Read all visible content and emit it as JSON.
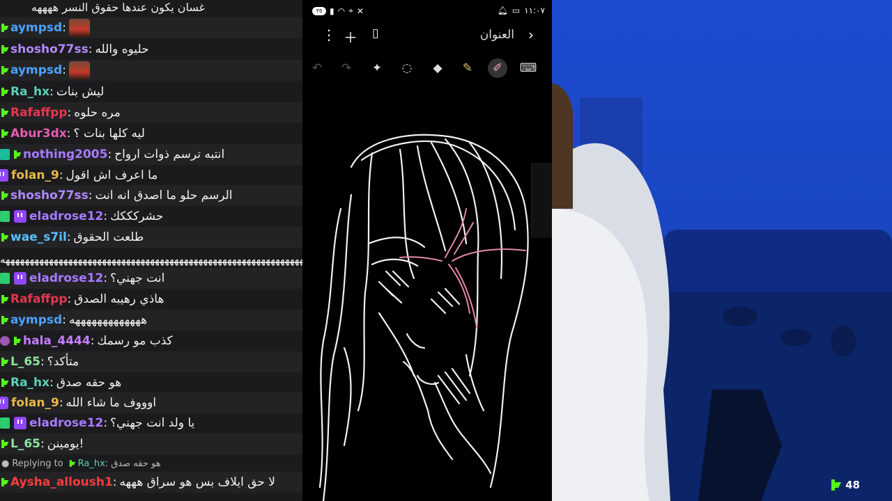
{
  "chat": {
    "top_line": "غسان يكون عندها حقوق النسر ههههه",
    "messages": [
      {
        "user": "aympsd",
        "color": "#4aa3ff",
        "text": "",
        "emote": "emote-face"
      },
      {
        "user": "shosho77ss",
        "color": "#b388ff",
        "text": "حليوه والله"
      },
      {
        "user": "aympsd",
        "color": "#4aa3ff",
        "text": "",
        "emote": "emote-face"
      },
      {
        "user": "Ra_hx",
        "color": "#5ad1b8",
        "text": "ليش بنات"
      },
      {
        "user": "Rafaffpp",
        "color": "#e6364f",
        "text": "مره حلوه"
      },
      {
        "user": "Abur3dx",
        "color": "#e65cb0",
        "text": "ليه كلها بنات ؟"
      },
      {
        "user": "nothing2005",
        "color": "#a77bff",
        "text": "انتبه ترسم ذوات ارواح"
      },
      {
        "user": "folan_9",
        "color": "#e8b84b",
        "text": "ما اعرف اش اقول"
      },
      {
        "user": "shosho77ss",
        "color": "#b388ff",
        "text": "الرسم حلو ما اصدق انه انت"
      },
      {
        "user": "eladrose12",
        "color": "#a77bff",
        "text": "حشركككك"
      },
      {
        "user": "wae_s7il",
        "color": "#58c0ff",
        "text": "طلعت الحقوق"
      },
      {
        "user": "eladrose12",
        "color": "#a77bff",
        "text": "انت جهني؟"
      },
      {
        "user": "Rafaffpp",
        "color": "#e6364f",
        "text": "هاذي رهيبه الصدق"
      },
      {
        "user": "aympsd",
        "color": "#4aa3ff",
        "text": "هههههههههههههه"
      },
      {
        "user": "hala_4444",
        "color": "#c77dff",
        "text": "كذب مو رسمك"
      },
      {
        "user": "L_65",
        "color": "#8fe39b",
        "text": "متأكد؟"
      },
      {
        "user": "Ra_hx",
        "color": "#5ad1b8",
        "text": "هو حقه صدق"
      },
      {
        "user": "folan_9",
        "color": "#e8b84b",
        "text": "اوووف ما شاء الله"
      },
      {
        "user": "eladrose12",
        "color": "#a77bff",
        "text": "يا ولد انت جهني؟"
      },
      {
        "user": "L_65",
        "color": "#8fe39b",
        "text": "!يومينن"
      },
      {
        "user": "Aysha_alloush1",
        "color": "#ff3b3b",
        "text": "لا حق ايلاف بس هو سراق هههه"
      }
    ],
    "separator_text": "ههههههههههههههههههههههههههههههههههههههههههههههههههههههههههههههههههههه",
    "reply": {
      "prefix": "Replying to",
      "user": "Ra_hx",
      "text": "هو حقه صدق"
    }
  },
  "phone": {
    "status_time": "١١:٠٧",
    "status_badge": "٣٥",
    "title": "العنوان",
    "tools": [
      "undo-icon",
      "redo-icon",
      "magic-icon",
      "lasso-icon",
      "eraser-icon",
      "highlighter-icon",
      "pen-icon",
      "keyboard-icon"
    ]
  },
  "stream": {
    "viewer_count": "48"
  }
}
